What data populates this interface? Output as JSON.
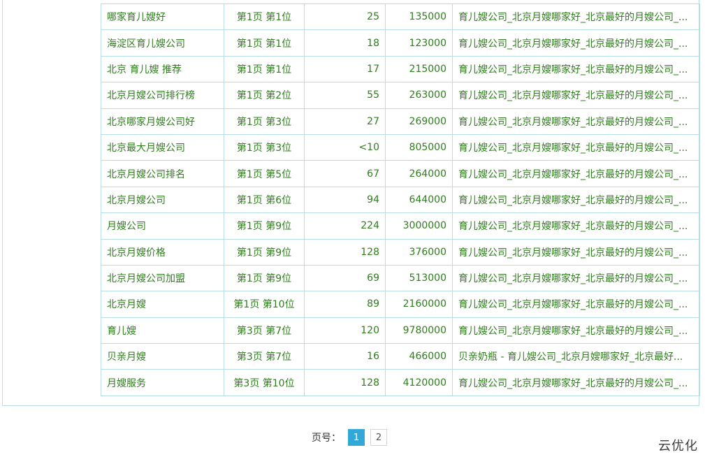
{
  "table": {
    "rows": [
      {
        "keyword": "哪家育儿嫂好",
        "rank": "第1页 第1位",
        "index": "25",
        "volume": "135000",
        "title": "育儿嫂公司_北京月嫂哪家好_北京最好的月嫂公司_..."
      },
      {
        "keyword": "海淀区育儿嫂公司",
        "rank": "第1页 第1位",
        "index": "18",
        "volume": "123000",
        "title": "育儿嫂公司_北京月嫂哪家好_北京最好的月嫂公司_..."
      },
      {
        "keyword": "北京 育儿嫂 推荐",
        "rank": "第1页 第1位",
        "index": "17",
        "volume": "215000",
        "title": "育儿嫂公司_北京月嫂哪家好_北京最好的月嫂公司_..."
      },
      {
        "keyword": "北京月嫂公司排行榜",
        "rank": "第1页 第2位",
        "index": "55",
        "volume": "263000",
        "title": "育儿嫂公司_北京月嫂哪家好_北京最好的月嫂公司_..."
      },
      {
        "keyword": "北京哪家月嫂公司好",
        "rank": "第1页 第3位",
        "index": "27",
        "volume": "269000",
        "title": "育儿嫂公司_北京月嫂哪家好_北京最好的月嫂公司_..."
      },
      {
        "keyword": "北京最大月嫂公司",
        "rank": "第1页 第3位",
        "index": "<10",
        "volume": "805000",
        "title": "育儿嫂公司_北京月嫂哪家好_北京最好的月嫂公司_..."
      },
      {
        "keyword": "北京月嫂公司排名",
        "rank": "第1页 第5位",
        "index": "67",
        "volume": "264000",
        "title": "育儿嫂公司_北京月嫂哪家好_北京最好的月嫂公司_..."
      },
      {
        "keyword": "北京月嫂公司",
        "rank": "第1页 第6位",
        "index": "94",
        "volume": "644000",
        "title": "育儿嫂公司_北京月嫂哪家好_北京最好的月嫂公司_..."
      },
      {
        "keyword": "月嫂公司",
        "rank": "第1页 第9位",
        "index": "224",
        "volume": "3000000",
        "title": "育儿嫂公司_北京月嫂哪家好_北京最好的月嫂公司_..."
      },
      {
        "keyword": "北京月嫂价格",
        "rank": "第1页 第9位",
        "index": "128",
        "volume": "376000",
        "title": "育儿嫂公司_北京月嫂哪家好_北京最好的月嫂公司_..."
      },
      {
        "keyword": "北京月嫂公司加盟",
        "rank": "第1页 第9位",
        "index": "69",
        "volume": "513000",
        "title": "育儿嫂公司_北京月嫂哪家好_北京最好的月嫂公司_..."
      },
      {
        "keyword": "北京月嫂",
        "rank": "第1页 第10位",
        "index": "89",
        "volume": "2160000",
        "title": "育儿嫂公司_北京月嫂哪家好_北京最好的月嫂公司_..."
      },
      {
        "keyword": "育儿嫂",
        "rank": "第3页 第7位",
        "index": "120",
        "volume": "9780000",
        "title": "育儿嫂公司_北京月嫂哪家好_北京最好的月嫂公司_..."
      },
      {
        "keyword": "贝亲月嫂",
        "rank": "第3页 第7位",
        "index": "16",
        "volume": "466000",
        "title": "贝亲奶瓶 - 育儿嫂公司_北京月嫂哪家好_北京最好..."
      },
      {
        "keyword": "月嫂服务",
        "rank": "第3页 第10位",
        "index": "128",
        "volume": "4120000",
        "title": "育儿嫂公司_北京月嫂哪家好_北京最好的月嫂公司_..."
      }
    ]
  },
  "pagination": {
    "label": "页号：",
    "pages": [
      "1",
      "2"
    ],
    "current": "1"
  },
  "watermark": "云优化",
  "colors": {
    "text_green": "#2e7d1c",
    "border": "#b7dde5",
    "active_page": "#32a8d8"
  }
}
